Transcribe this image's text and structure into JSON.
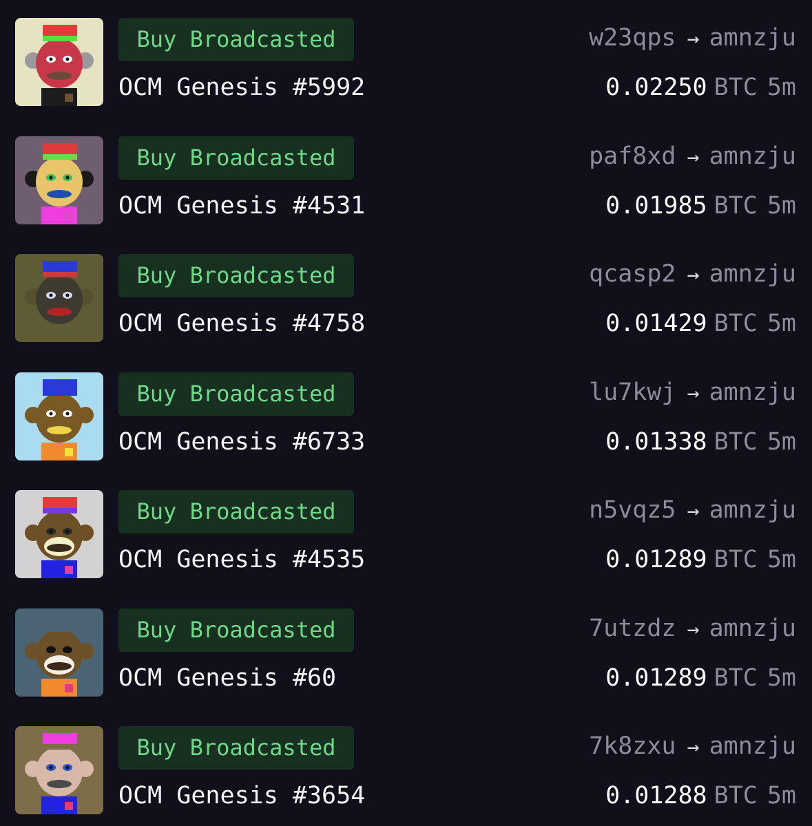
{
  "currency": "BTC",
  "arrow": "→",
  "badge_label": "Buy Broadcasted",
  "sales": [
    {
      "name": "OCM Genesis #5992",
      "from": "w23qps",
      "to": "amnzju",
      "price": "0.02250",
      "age": "5m",
      "art": {
        "bg": "#e6e3c3",
        "face": "#c8384a",
        "ear": "#9a9a9a",
        "muzzle": "#c8384a",
        "mouth": "#6b4a3a",
        "hat": "#e23b3b",
        "hatband": "#5bdc3b",
        "shirt": "#1c1c1c",
        "badge": "#6b5234",
        "eye": "#ffffff"
      }
    },
    {
      "name": "OCM Genesis #4531",
      "from": "paf8xd",
      "to": "amnzju",
      "price": "0.01985",
      "age": "5m",
      "art": {
        "bg": "#6e5e70",
        "face": "#e8c46a",
        "ear": "#1a1a1a",
        "muzzle": "#e8c46a",
        "mouth": "#1e4fa6",
        "hat": "#e23b3b",
        "hatband": "#6adc4a",
        "shirt": "#ee3ee0",
        "badge": "#d84dc0",
        "eye": "#3fbf4f"
      }
    },
    {
      "name": "OCM Genesis #4758",
      "from": "qcasp2",
      "to": "amnzju",
      "price": "0.01429",
      "age": "5m",
      "art": {
        "bg": "#5e5c34",
        "face": "#3d3a2f",
        "ear": "#55502f",
        "muzzle": "#3d3a2f",
        "mouth": "#b32424",
        "hat": "#2a3ad9",
        "hatband": "#c83b3b",
        "shirt": "#5e5c34",
        "badge": "#5e5c34",
        "eye": "#d8d8f0"
      }
    },
    {
      "name": "OCM Genesis #6733",
      "from": "lu7kwj",
      "to": "amnzju",
      "price": "0.01338",
      "age": "5m",
      "art": {
        "bg": "#a9dcf0",
        "face": "#7a5a24",
        "ear": "#7a5a24",
        "muzzle": "#7a5a24",
        "mouth": "#efd24a",
        "hat": "#2a3ad9",
        "hatband": "#2a3ad9",
        "shirt": "#f08a2c",
        "badge": "#f5e23a",
        "eye": "#ffffff"
      }
    },
    {
      "name": "OCM Genesis #4535",
      "from": "n5vqz5",
      "to": "amnzju",
      "price": "0.01289",
      "age": "5m",
      "art": {
        "bg": "#d2d2d2",
        "face": "#6e5026",
        "ear": "#6e5026",
        "muzzle": "#f0f0c8",
        "mouth": "#3a2a1a",
        "hat": "#e23b3b",
        "hatband": "#7a3ad9",
        "shirt": "#2222e0",
        "badge": "#e03cb8",
        "eye": "#2a2a2a"
      }
    },
    {
      "name": "OCM Genesis #60",
      "from": "7utzdz",
      "to": "amnzju",
      "price": "0.01289",
      "age": "5m",
      "art": {
        "bg": "#4a6474",
        "face": "#6b5028",
        "ear": "#6b5028",
        "muzzle": "#f4f0e6",
        "mouth": "#3a2a1a",
        "hat": "#4a6474",
        "hatband": "#4a6474",
        "shirt": "#f08a2c",
        "badge": "#e03c7a",
        "eye": "#111111"
      }
    },
    {
      "name": "OCM Genesis #3654",
      "from": "7k8zxu",
      "to": "amnzju",
      "price": "0.01288",
      "age": "5m",
      "art": {
        "bg": "#7d6d48",
        "face": "#d8b8a8",
        "ear": "#d8b8a8",
        "muzzle": "#d8b8a8",
        "mouth": "#4a4a4a",
        "hat": "#ee3ee0",
        "hatband": "#7d6d48",
        "shirt": "#2222e0",
        "badge": "#e03c7a",
        "eye": "#2a54c8"
      }
    }
  ]
}
